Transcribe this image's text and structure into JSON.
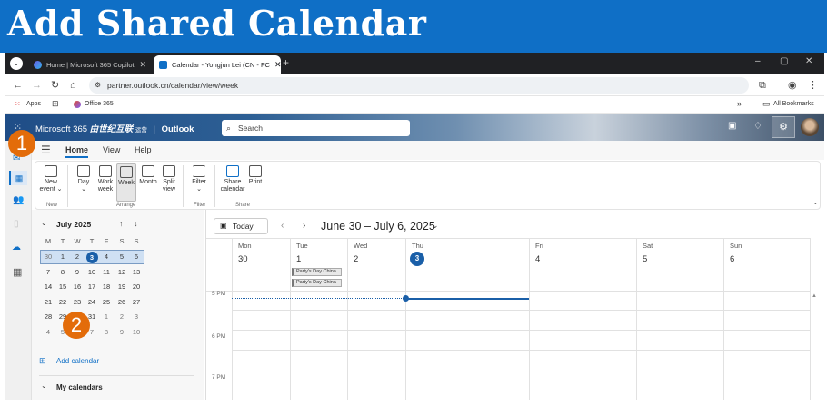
{
  "banner": {
    "title": "Add Shared Calendar"
  },
  "browser": {
    "tabs": [
      {
        "label": "Home | Microsoft 365 Copilot",
        "active": false
      },
      {
        "label": "Calendar - Yongjun Lei (CN - FC",
        "active": true
      }
    ],
    "new_tab": "+",
    "url": "partner.outlook.cn/calendar/view/week",
    "bookmarks": {
      "apps": "Apps",
      "office": "Office 365",
      "all": "All Bookmarks",
      "more": "»"
    },
    "window": {
      "min": "–",
      "max": "▢",
      "close": "✕"
    }
  },
  "suite": {
    "brand": "Microsoft 365",
    "brand_suffix": "由世纪互联",
    "brand_small": "运营",
    "app": "Outlook",
    "search_placeholder": "Search"
  },
  "ribbon": {
    "tabs": [
      "Home",
      "View",
      "Help"
    ],
    "active_tab": "Home",
    "new_event": [
      "New",
      "event ⌄"
    ],
    "day": [
      "Day",
      "⌄"
    ],
    "work_week": [
      "Work",
      "week"
    ],
    "week": "Week",
    "month": "Month",
    "split_view": [
      "Split",
      "view"
    ],
    "filter": [
      "Filter",
      "⌄"
    ],
    "share_calendar": [
      "Share",
      "calendar"
    ],
    "print": "Print",
    "groups": {
      "new": "New",
      "arrange": "Arrange",
      "filter": "Filter",
      "share": "Share"
    }
  },
  "minical": {
    "month": "July 2025",
    "weekdays": [
      "M",
      "T",
      "W",
      "T",
      "F",
      "S",
      "S"
    ],
    "weeks": [
      [
        "30",
        "1",
        "2",
        "3",
        "4",
        "5",
        "6"
      ],
      [
        "7",
        "8",
        "9",
        "10",
        "11",
        "12",
        "13"
      ],
      [
        "14",
        "15",
        "16",
        "17",
        "18",
        "19",
        "20"
      ],
      [
        "21",
        "22",
        "23",
        "24",
        "25",
        "26",
        "27"
      ],
      [
        "28",
        "29",
        "30",
        "31",
        "1",
        "2",
        "3"
      ],
      [
        "4",
        "5",
        "6",
        "7",
        "8",
        "9",
        "10"
      ]
    ],
    "today": "3"
  },
  "leftpane": {
    "add_calendar": "Add calendar",
    "my_calendars": "My calendars"
  },
  "calendar": {
    "today_btn": "Today",
    "range": "June 30 – July 6, 2025",
    "days": [
      {
        "name": "Mon",
        "num": "30"
      },
      {
        "name": "Tue",
        "num": "1"
      },
      {
        "name": "Wed",
        "num": "2"
      },
      {
        "name": "Thu",
        "num": "3"
      },
      {
        "name": "Fri",
        "num": "4"
      },
      {
        "name": "Sat",
        "num": "5"
      },
      {
        "name": "Sun",
        "num": "6"
      }
    ],
    "events": [
      "Party's Day China",
      "Party's Day China"
    ],
    "times": [
      "5 PM",
      "6 PM",
      "7 PM"
    ]
  },
  "badges": [
    "1",
    "2"
  ],
  "colors": {
    "accent": "#0f6fc6",
    "badge": "#e36c0a",
    "today": "#1a5fa8"
  }
}
